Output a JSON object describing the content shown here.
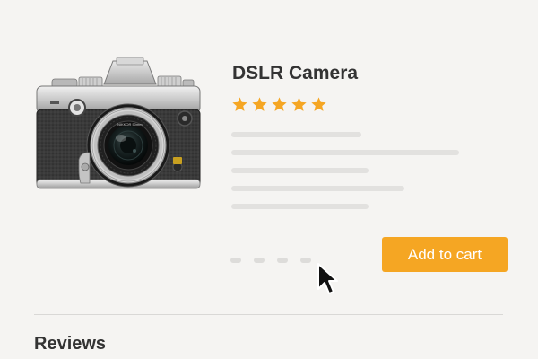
{
  "product": {
    "title": "DSLR Camera",
    "image_icon": "camera-icon",
    "rating": {
      "stars": 5,
      "max": 5,
      "color": "#f5a623",
      "icon": "star-icon"
    }
  },
  "actions": {
    "add_to_cart_label": "Add to cart",
    "button_color": "#f5a623"
  },
  "pager": {
    "dots": 4
  },
  "reviews": {
    "heading": "Reviews"
  }
}
